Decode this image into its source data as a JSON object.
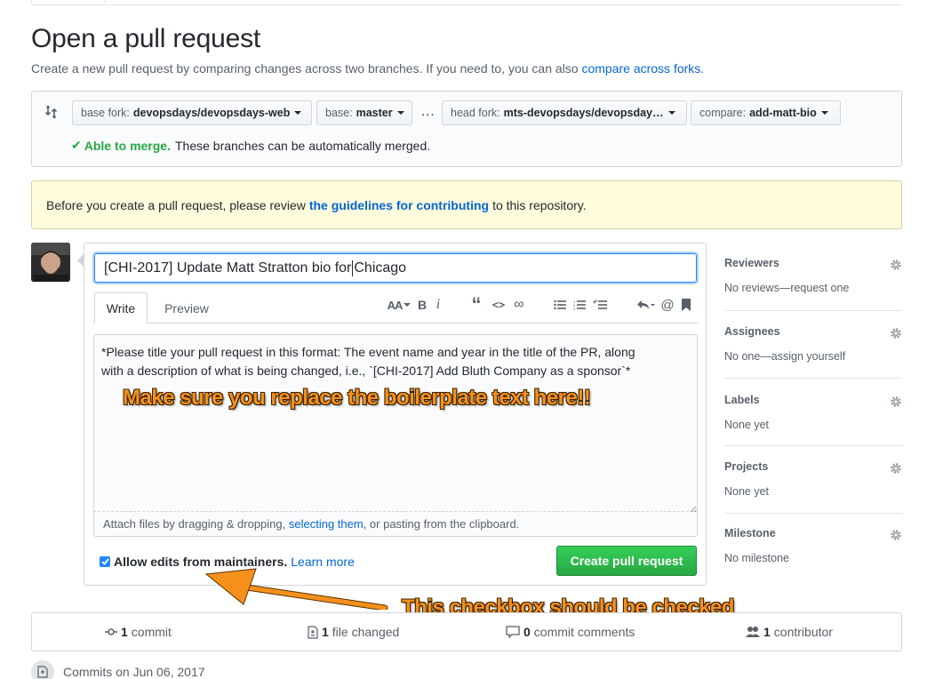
{
  "page": {
    "title": "Open a pull request",
    "subtitle": "Create a new pull request by comparing changes across two branches. If you need to, you can also",
    "subtitle_link": "compare across forks",
    "subtitle_end": "."
  },
  "range": {
    "base_fork_label": "base fork:",
    "base_fork_value": "devopsdays/devopsdays-web",
    "base_label": "base:",
    "base_value": "master",
    "dots": "...",
    "head_fork_label": "head fork:",
    "head_fork_value": "mts-devopsdays/devopsday…",
    "compare_label": "compare:",
    "compare_value": "add-matt-bio",
    "merge_ok": "Able to merge.",
    "merge_text": "These branches can be automatically merged."
  },
  "flash": {
    "before": "Before you create a pull request, please review",
    "link": "the guidelines for contributing",
    "after": "to this repository."
  },
  "form": {
    "title_before_cursor": "[CHI-2017] Update Matt Stratton bio for",
    "title_after_cursor": "Chicago",
    "tab_write": "Write",
    "tab_preview": "Preview",
    "toolbar": {
      "header": "AA",
      "bold": "B",
      "italic": "i",
      "quote": "“",
      "code": "<>",
      "link": "∞",
      "bullets": "☰",
      "numbered": "☰",
      "tasks": "☰",
      "reply": "↰",
      "mention": "@",
      "bookmark": "▮"
    },
    "body_line1": "*Please title your pull request in this format: The event name and year in the title of the PR, along",
    "body_line2": "with a description of what is being changed, i.e., `[CHI-2017] Add Bluth Company as a sponsor`*",
    "attach_before": "Attach files by dragging & dropping,",
    "attach_link": "selecting them",
    "attach_after": ", or pasting from the clipboard.",
    "allow_edits": "Allow edits from maintainers.",
    "learn_more": "Learn more",
    "create_button": "Create pull request",
    "allow_edits_checked": true
  },
  "annotations": {
    "boilerplate": "Make sure you replace the boilerplate text here!!",
    "checkbox": "This checkbox should be checked"
  },
  "sidebar": {
    "reviewers": {
      "title": "Reviewers",
      "value": "No reviews—request one"
    },
    "assignees": {
      "title": "Assignees",
      "value": "No one—assign yourself"
    },
    "labels": {
      "title": "Labels",
      "value": "None yet"
    },
    "projects": {
      "title": "Projects",
      "value": "None yet"
    },
    "milestone": {
      "title": "Milestone",
      "value": "No milestone"
    }
  },
  "summary": {
    "commits_count": "1",
    "commits_label": "commit",
    "files_count": "1",
    "files_label": "file changed",
    "comments_count": "0",
    "comments_label": "commit comments",
    "contributors_count": "1",
    "contributors_label": "contributor"
  },
  "commits_header": "Commits on Jun 06, 2017",
  "colors": {
    "link": "#0366d6",
    "success": "#28a745",
    "annotation": "#f6901d",
    "flash_bg": "#fffbdd"
  }
}
